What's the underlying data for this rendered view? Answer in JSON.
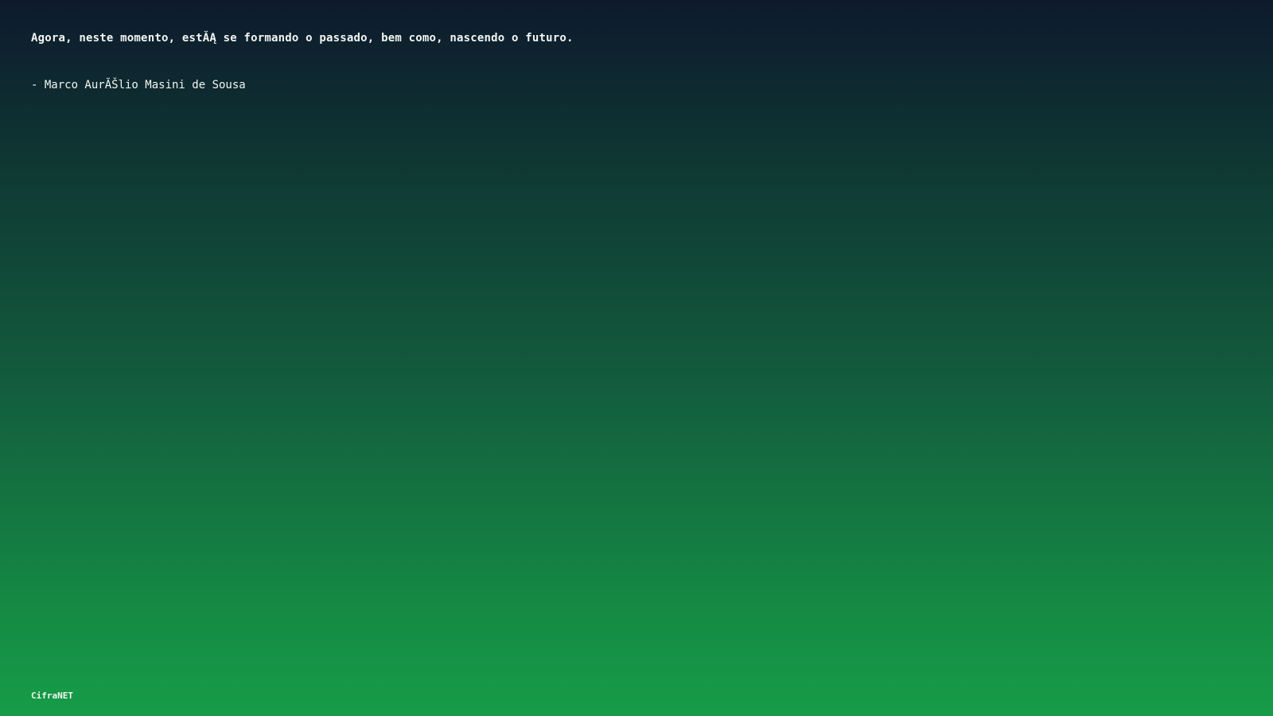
{
  "quote": {
    "text": "Agora, neste momento, estĂĄ se formando o passado, bem como, nascendo o futuro.",
    "author": "- Marco AurĂŠlio Masini de Sousa"
  },
  "brand": {
    "name": "CifraNET"
  },
  "colors": {
    "gradient_top": "#0d1a2d",
    "gradient_bottom": "#169c47",
    "text": "#f2f5f2"
  }
}
